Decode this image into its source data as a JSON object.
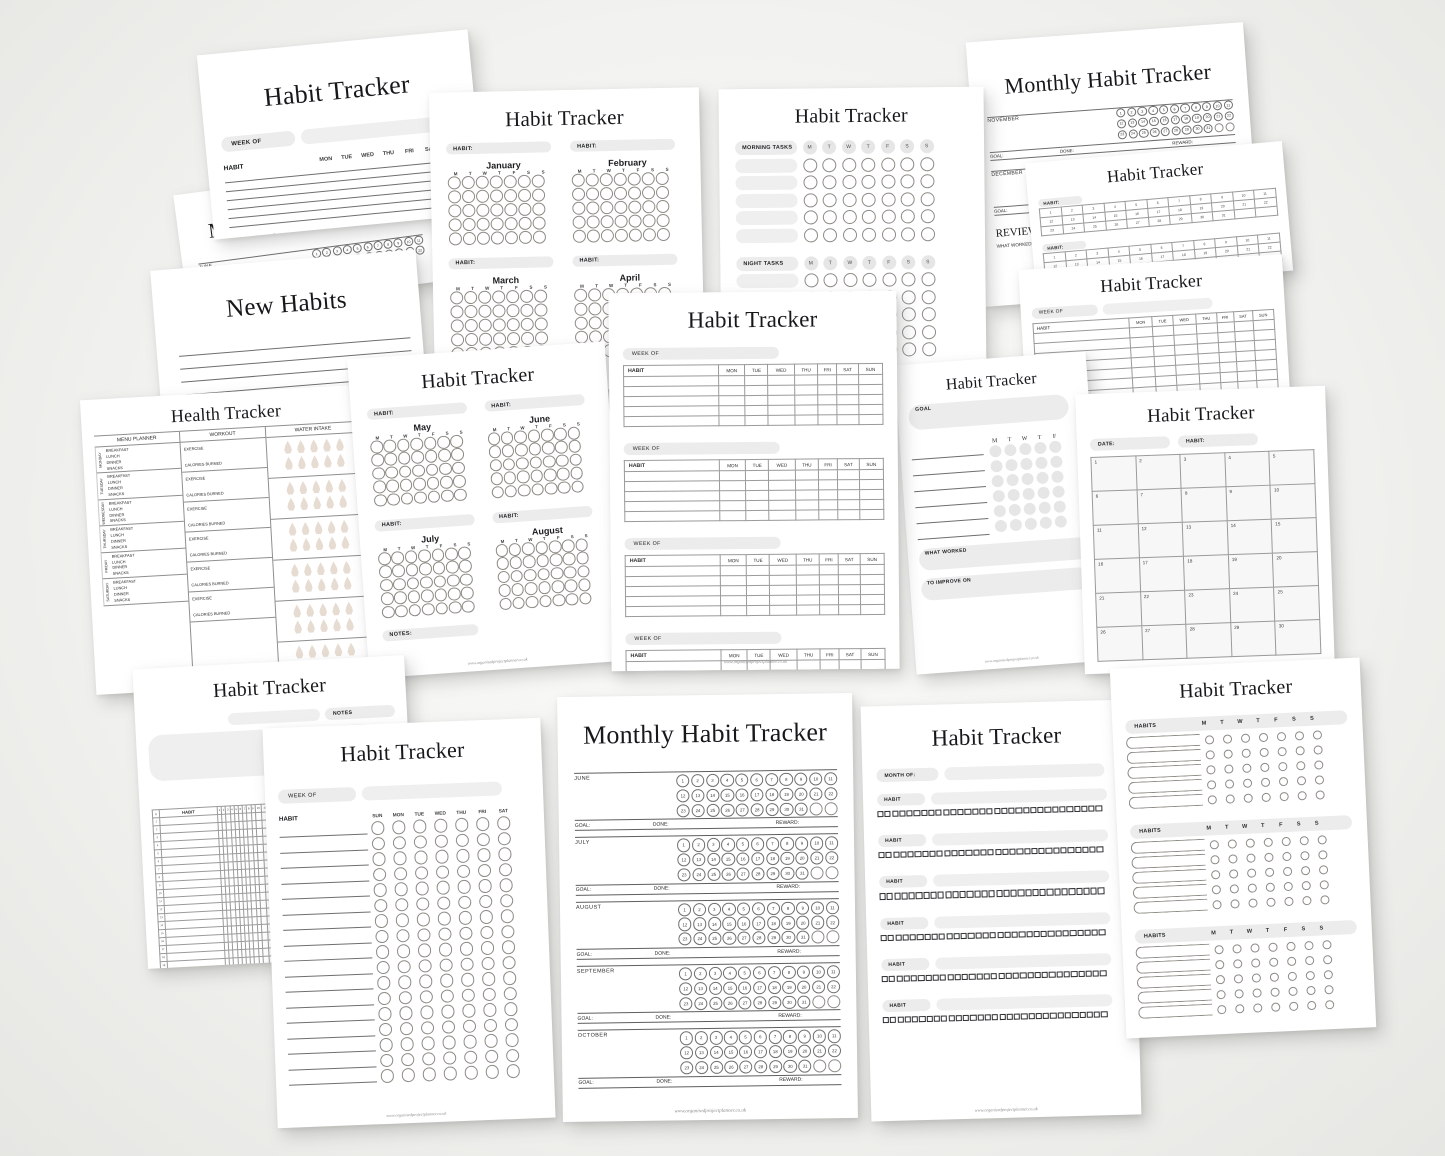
{
  "brand": {
    "footer_url": "www.organisedprojectplanner.co.uk",
    "accent": "#e7dcd2",
    "ink": "#16181a",
    "pill_bg": "#ececec"
  },
  "labels": {
    "habit_tracker": "Habit Tracker",
    "monthly_habit_tracker": "Monthly Habit Tracker",
    "new_habits": "New Habits",
    "health_tracker": "Health Tracker",
    "habit_colon": "HABIT:",
    "habit": "HABIT",
    "habits": "HABITS",
    "week_of": "WEEK OF",
    "month_of": "MONTH OF:",
    "date_colon": "DATE:",
    "goal": "GOAL",
    "goal_colon": "GOAL:",
    "done_colon": "DONE:",
    "reward_colon": "REWARD:",
    "notes": "NOTES",
    "notes_colon": "NOTES:",
    "what_worked": "WHAT WORKED",
    "to_improve_on": "TO IMPROVE ON",
    "morning_tasks": "MORNING TASKS",
    "night_tasks": "NIGHT TASKS",
    "menu_planner": "MENU PLANNER",
    "workout": "WORKOUT",
    "water_intake": "WATER INTAKE",
    "exercise": "EXERCISE",
    "calories_burned": "CALORIES BURNED"
  },
  "day_initials": [
    "M",
    "T",
    "W",
    "T",
    "F",
    "S",
    "S"
  ],
  "days_mon_first": [
    "MON",
    "TUE",
    "WED",
    "THU",
    "FRI",
    "SAT",
    "SUN"
  ],
  "days_sun_first": [
    "SUN",
    "MON",
    "TUE",
    "WED",
    "THU",
    "FRI",
    "SAT"
  ],
  "meals": [
    "BREAKFAST",
    "LUNCH",
    "DINNER",
    "SNACKS"
  ],
  "weekdays_full": [
    "MONDAY",
    "TUESDAY",
    "WEDNESDAY",
    "THURSDAY",
    "FRIDAY",
    "SATURDAY"
  ],
  "pages": [
    {
      "id": "p1-weekly-top",
      "title": "Habit Tracker",
      "fields": [
        "WEEK OF"
      ],
      "columns": [
        "MON",
        "TUE",
        "WED",
        "THU",
        "FRI",
        "SAT",
        "SUN"
      ]
    },
    {
      "id": "p2-jan-feb-mar",
      "title": "Habit Tracker",
      "months": [
        "January",
        "February",
        "March",
        "April"
      ]
    },
    {
      "id": "p3-morning-night",
      "title": "Habit Tracker",
      "sections": [
        "MORNING TASKS",
        "NIGHT TASKS"
      ],
      "rows": 5
    },
    {
      "id": "p4-monthly-nov-dec",
      "title": "Monthly Habit Tracker",
      "months": [
        "NOVEMBER",
        "DECEMBER"
      ]
    },
    {
      "id": "p5-monthly-june",
      "title": "Monthly Habit Tracker",
      "months": [
        "JUNE"
      ]
    },
    {
      "id": "p6-new-habits",
      "title": "New Habits",
      "lines": 6
    },
    {
      "id": "p7-health-tracker",
      "title": "Health Tracker",
      "columns": [
        "MENU PLANNER",
        "WORKOUT",
        "WATER INTAKE"
      ]
    },
    {
      "id": "p8-may-aug",
      "title": "Habit Tracker",
      "months": [
        "May",
        "June",
        "July",
        "August"
      ]
    },
    {
      "id": "p9-four-weeks",
      "title": "Habit Tracker",
      "fields": [
        "WEEK OF",
        "WEEK OF",
        "WEEK OF",
        "WEEK OF"
      ]
    },
    {
      "id": "p10-goal-review",
      "title": "Habit Tracker",
      "fields": [
        "GOAL",
        "WHAT WORKED",
        "TO IMPROVE ON"
      ]
    },
    {
      "id": "p11-number-grid",
      "title": "Habit Tracker",
      "fields": [
        "HABIT:",
        "HABIT:",
        "HABIT:"
      ]
    },
    {
      "id": "p12-weekly-right",
      "title": "Habit Tracker",
      "fields": [
        "WEEK OF"
      ]
    },
    {
      "id": "p13-calendar",
      "title": "Habit Tracker",
      "fields": [
        "DATE:",
        "HABIT:"
      ]
    },
    {
      "id": "p14-notes-grid",
      "title": "Habit Tracker",
      "fields": [
        "NOTES"
      ]
    },
    {
      "id": "p15-weekly-circles",
      "title": "Habit Tracker",
      "fields": [
        "WEEK OF"
      ]
    },
    {
      "id": "p16-monthly-jun-oct",
      "title": "Monthly Habit Tracker",
      "months": [
        "JUNE",
        "JULY",
        "AUGUST",
        "SEPTEMBER",
        "OCTOBER"
      ]
    },
    {
      "id": "p17-checkbox-month",
      "title": "Habit Tracker",
      "fields": [
        "MONTH OF:"
      ],
      "habit_rows": 6,
      "checkboxes_per_row": 31
    },
    {
      "id": "p18-habits-weekly",
      "title": "Habit Tracker",
      "sections": [
        "HABITS",
        "HABITS",
        "HABITS"
      ]
    }
  ],
  "monthly_calendar_days": {
    "row1": [
      1,
      2,
      3,
      4,
      5,
      6,
      7,
      8,
      9,
      10,
      11
    ],
    "row2": [
      12,
      13,
      14,
      15,
      16,
      17,
      18,
      19,
      20,
      21,
      22
    ],
    "row3": [
      23,
      24,
      25,
      26,
      27,
      28,
      29,
      30,
      31
    ]
  },
  "calendar_numbers": [
    1,
    2,
    3,
    4,
    5,
    6,
    7,
    8,
    9,
    10,
    11,
    12,
    13,
    14,
    15,
    16,
    17,
    18,
    19,
    20,
    21,
    22,
    23,
    24,
    25,
    26,
    27,
    28,
    29,
    30
  ],
  "number_grid_rows": [
    [
      1,
      2,
      3,
      4,
      5,
      6,
      7,
      8,
      9,
      10,
      11
    ],
    [
      12,
      13,
      14,
      15,
      16,
      17,
      18,
      19,
      20,
      21,
      22
    ],
    [
      23,
      24,
      25,
      26,
      27,
      28,
      29,
      30,
      31
    ]
  ]
}
